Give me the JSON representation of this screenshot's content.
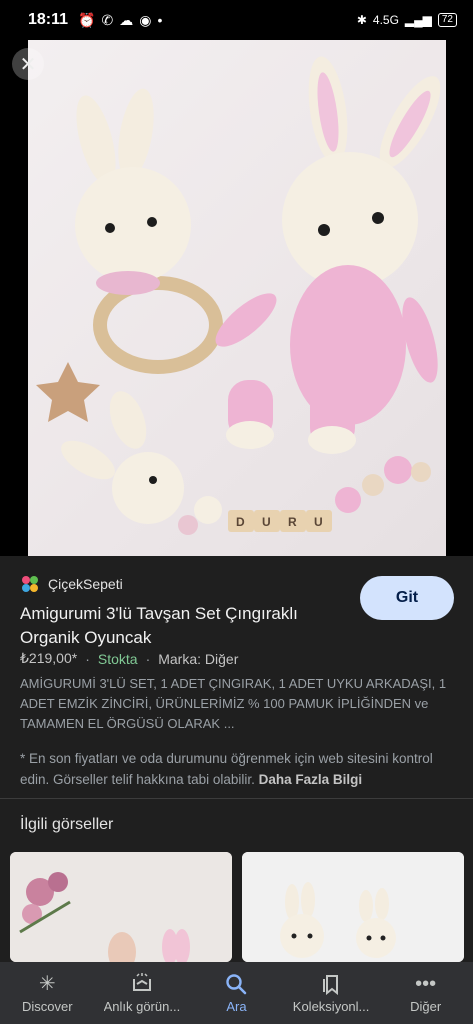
{
  "status_bar": {
    "time": "18:11",
    "network": "4.5G",
    "battery": "72"
  },
  "hero": {
    "bead_letters": [
      "D",
      "U",
      "R",
      "U"
    ]
  },
  "result": {
    "source": "ÇiçekSepeti",
    "title": "Amigurumi 3'lü Tavşan Set Çıngıraklı Organik Oyuncak",
    "price": "₺219,00*",
    "stock": "Stokta",
    "brand": "Marka: Diğer",
    "description": "AMİGURUMİ 3'LÜ SET, 1 ADET ÇINGIRAK, 1 ADET UYKU ARKADAŞI, 1 ADET EMZİK ZİNCİRİ, ÜRÜNLERİMİZ % 100 PAMUK İPLİĞİNDEN ve TAMAMEN EL ÖRGÜSÜ OLARAK ...",
    "note": "* En son fiyatları ve oda durumunu öğrenmek için web sitesini kontrol edin. Görseller telif hakkına tabi olabilir.",
    "more_link": "Daha Fazla Bilgi",
    "visit_button": "Git"
  },
  "related": {
    "title": "İlgili görseller"
  },
  "bottom_nav": [
    {
      "label": "Discover",
      "icon": "asterisk-icon"
    },
    {
      "label": "Anlık görün...",
      "icon": "updates-icon"
    },
    {
      "label": "Ara",
      "icon": "search-icon",
      "active": true
    },
    {
      "label": "Koleksiyonl...",
      "icon": "collections-icon"
    },
    {
      "label": "Diğer",
      "icon": "more-icon"
    }
  ],
  "colors": {
    "background": "#1f1f1f",
    "accent": "#8ab4f8",
    "stock_green": "#81c995",
    "button_bg": "#d3e3fd"
  }
}
